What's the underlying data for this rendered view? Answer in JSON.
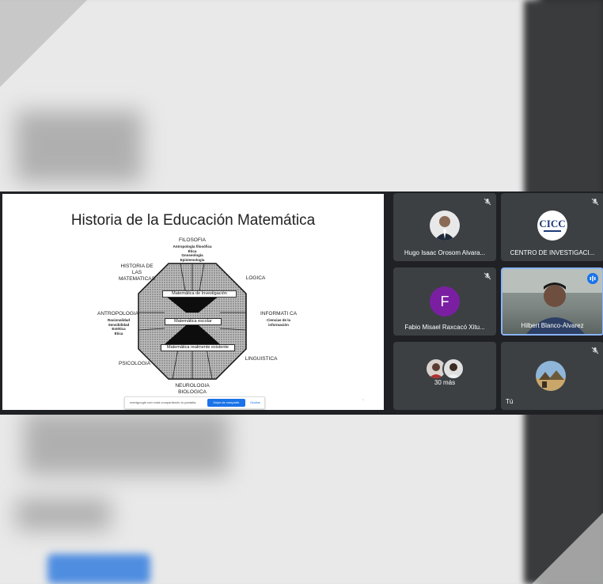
{
  "slide": {
    "title": "Historia de la Educación Matemática",
    "labels": {
      "filosofia": "FILOSOFIA",
      "filosofia_sub": [
        "Antropología filosófica",
        "Ética",
        "Gnoseología",
        "Epistemología"
      ],
      "historia": [
        "HISTORIA DE",
        "LAS",
        "MATEMATICAS"
      ],
      "logica": "LOGICA",
      "antropologia": "ANTROPOLOGIA",
      "antropologia_sub": [
        "Racionalidad",
        "Sensibilidad",
        "Estética",
        "Ética"
      ],
      "informatica": "INFORMATI CA",
      "informatica_sub": [
        "Ciencias de la",
        "información"
      ],
      "psicologia": "PSICOLOGIA",
      "linguistica": "LINGUISTICA",
      "neurologia": "NEUROLOGIA",
      "biologica": "BIOLOGICA"
    },
    "bands": [
      "Matemática de Investigación",
      "Matemática escolar",
      "Matemática realmente existente"
    ],
    "share_bar": {
      "message": "meetgoogle.com está compartiendo tu pantalla.",
      "stop_label": "Dejar de compartir",
      "hide_label": "Ocultar"
    }
  },
  "participants": [
    {
      "name": "Hugo Isaac Orosom Alvara...",
      "type": "photo",
      "muted": true
    },
    {
      "name": "CENTRO DE INVESTIGACI...",
      "type": "logo",
      "logo_text": "CICC",
      "muted": true
    },
    {
      "name": "Fabio Misael Raxcacó Xitu...",
      "type": "initial",
      "initial": "F",
      "avatar_color": "#7b1fa2",
      "muted": true
    },
    {
      "name": "Hilbert Blanco-Álvarez",
      "type": "video",
      "speaking": true
    },
    {
      "name": "30 más",
      "type": "group",
      "muted": false
    },
    {
      "name": "Tú",
      "type": "self",
      "muted": true
    }
  ],
  "colors": {
    "accent": "#1a73e8",
    "tile_bg": "#3c4043",
    "active_border": "#8ab4f8"
  }
}
